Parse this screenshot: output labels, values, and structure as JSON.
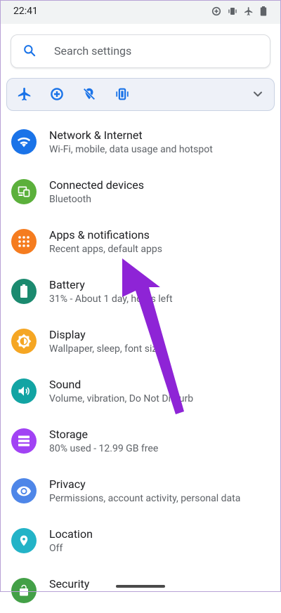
{
  "status_bar": {
    "time": "22:41",
    "icons": [
      "data-saver-icon",
      "vibrate-icon",
      "airplane-icon",
      "battery-icon"
    ]
  },
  "search": {
    "placeholder": "Search settings"
  },
  "quick_settings": {
    "icons": [
      "airplane-icon",
      "data-saver-icon",
      "location-off-icon",
      "vibrate-icon"
    ],
    "expand": "chevron-down-icon"
  },
  "settings": [
    {
      "title": "Network & Internet",
      "subtitle": "Wi-Fi, mobile, data usage and hotspot",
      "color": "#1a73e8",
      "icon": "wifi-icon"
    },
    {
      "title": "Connected devices",
      "subtitle": "Bluetooth",
      "color": "#5bb03b",
      "icon": "devices-icon"
    },
    {
      "title": "Apps & notifications",
      "subtitle": "Recent apps, default apps",
      "color": "#f57c1f",
      "icon": "apps-icon"
    },
    {
      "title": "Battery",
      "subtitle": "31% - About 1 day, hours left",
      "color": "#1b8a6f",
      "icon": "battery-icon"
    },
    {
      "title": "Display",
      "subtitle": "Wallpaper, sleep, font size",
      "color": "#f5a623",
      "icon": "brightness-icon"
    },
    {
      "title": "Sound",
      "subtitle": "Volume, vibration, Do Not Disturb",
      "color": "#12a4a3",
      "icon": "volume-icon"
    },
    {
      "title": "Storage",
      "subtitle": "80% used - 12.99 GB free",
      "color": "#a142f4",
      "icon": "storage-icon"
    },
    {
      "title": "Privacy",
      "subtitle": "Permissions, account activity, personal data",
      "color": "#4e86e8",
      "icon": "eye-icon"
    },
    {
      "title": "Location",
      "subtitle": "Off",
      "color": "#23b3c7",
      "icon": "location-pin-icon"
    },
    {
      "title": "Security",
      "subtitle": "",
      "color": "#43a047",
      "icon": "lock-icon"
    }
  ],
  "annotation": {
    "color": "#8e24d6"
  }
}
